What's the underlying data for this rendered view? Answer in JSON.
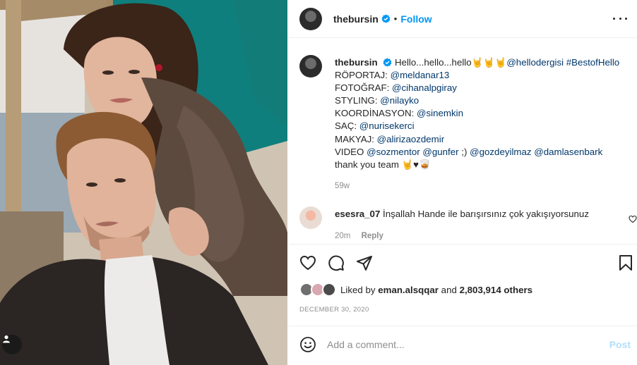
{
  "post": {
    "username": "thebursin",
    "separator": "•",
    "follow_label": "Follow",
    "icons": {
      "verified": "verified-badge-icon",
      "more": "more-options-icon",
      "tag": "user-tag-icon"
    },
    "colors": {
      "accent": "#0095f6",
      "verified": "#0095f6",
      "link": "#00376b",
      "muted": "#8e8e8e",
      "post_disabled": "#b2dffc"
    }
  },
  "caption": {
    "username": "thebursin",
    "intro": "Hello...hello...hello",
    "intro_emoji": "🤘🤘🤘",
    "mention_main": "@hellodergisi",
    "hashtag": "#BestofHello",
    "credits": [
      {
        "label": "RÖPORTAJ:",
        "handle": "@meldanar13"
      },
      {
        "label": "FOTOĞRAF:",
        "handle": "@cihanalpgiray"
      },
      {
        "label": "STYLING:",
        "handle": "@nilayko"
      },
      {
        "label": "KOORDİNASYON:",
        "handle": "@sinemkin"
      },
      {
        "label": "SAÇ:",
        "handle": "@nurisekerci"
      },
      {
        "label": "MAKYAJ:",
        "handle": "@alirizaozdemir"
      }
    ],
    "video": {
      "label": "VIDEO",
      "h1": "@sozmentor",
      "h2": "@gunfer",
      "sep": ";)",
      "h3": "@gozdeyilmaz",
      "h4": "@damlasenbark"
    },
    "thanks": "thank you team",
    "thanks_emoji": "🤘♥🥃",
    "timestamp": "59w"
  },
  "comment": {
    "username": "esesra_07",
    "text": "İnşallah Hande ile barışırsınız çok yakışıyorsunuz",
    "time": "20m",
    "reply_label": "Reply"
  },
  "actions": {
    "icons": [
      "heart-icon",
      "comment-icon",
      "share-icon",
      "bookmark-icon"
    ]
  },
  "likes": {
    "prefix": "Liked by",
    "user": "eman.alsqqar",
    "mid": "and",
    "count": "2,803,914 others",
    "date": "DECEMBER 30, 2020"
  },
  "add_comment": {
    "placeholder": "Add a comment...",
    "post_label": "Post",
    "emoji_icon": "emoji-icon"
  }
}
